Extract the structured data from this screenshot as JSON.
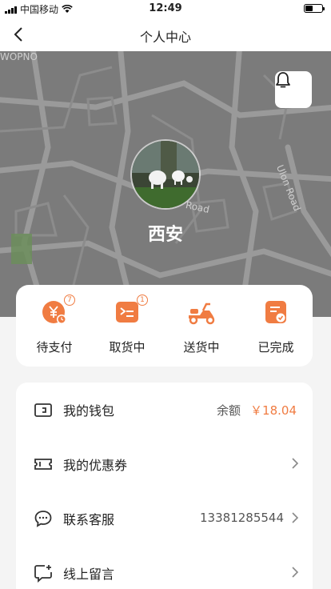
{
  "status": {
    "carrier": "中国移动",
    "time": "12:49"
  },
  "nav": {
    "title": "个人中心"
  },
  "map": {
    "label_1": "WOPNO",
    "label_2": "Road",
    "label_3": "Ulon Road"
  },
  "profile": {
    "city": "西安"
  },
  "orders": [
    {
      "label": "待支付",
      "badge": "7",
      "icon": "yuan-clock-icon"
    },
    {
      "label": "取货中",
      "badge": "1",
      "icon": "pickup-icon"
    },
    {
      "label": "送货中",
      "badge": "",
      "icon": "scooter-icon"
    },
    {
      "label": "已完成",
      "badge": "",
      "icon": "completed-icon"
    }
  ],
  "menu": {
    "wallet": {
      "label": "我的钱包",
      "balance_label": "余额",
      "balance": "￥18.04"
    },
    "coupons": {
      "label": "我的优惠券"
    },
    "service": {
      "label": "联系客服",
      "phone": "13381285544"
    },
    "message": {
      "label": "线上留言"
    }
  },
  "colors": {
    "accent": "#f07c42",
    "map_bg": "#7b7b7b"
  }
}
